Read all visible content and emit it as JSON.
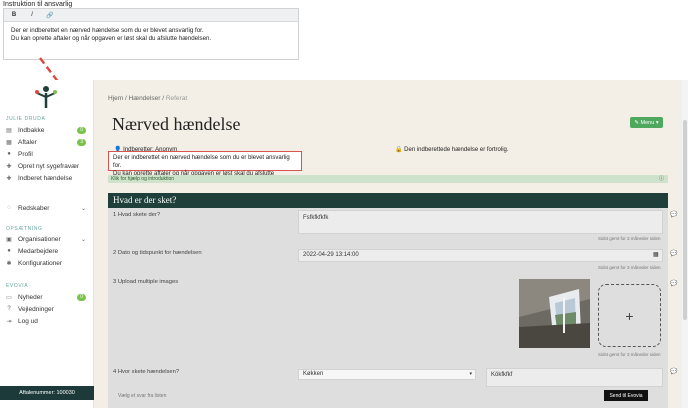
{
  "editor": {
    "title": "Instruktion til ansvarlig",
    "toolbar": {
      "bold": "B",
      "italic": "I",
      "link": "🔗"
    },
    "line1": "Der er indberettet en nærved hændelse som du er blevet ansvarlig for.",
    "line2": "Du kan oprette aftaler og når opgaven er løst skal du afslutte hændelsen."
  },
  "sidebar": {
    "section1": "JULIE DRUDA",
    "items1": [
      {
        "label": "Indbakke",
        "badge": "0",
        "icon": "inbox-icon"
      },
      {
        "label": "Aftaler",
        "badge": "3",
        "icon": "calendar-icon"
      },
      {
        "label": "Profil",
        "icon": "person-icon"
      },
      {
        "label": "Opret nyt sygefravær",
        "icon": "plus-icon"
      },
      {
        "label": "Indberet hændelse",
        "icon": "plus-icon"
      }
    ],
    "redskaber": "Redskaber",
    "section2": "OPSÆTNING",
    "items2": [
      {
        "label": "Organisationer",
        "icon": "org-icon"
      },
      {
        "label": "Medarbejdere",
        "icon": "person-icon"
      },
      {
        "label": "Konfigurationer",
        "icon": "gear-icon"
      }
    ],
    "section3": "EVOVIA",
    "items3": [
      {
        "label": "Nyheder",
        "badge": "0",
        "icon": "news-icon"
      },
      {
        "label": "Vejledninger",
        "icon": "question-icon"
      },
      {
        "label": "Log ud",
        "icon": "logout-icon"
      }
    ],
    "footer": "Aftalenummer: 100030"
  },
  "page": {
    "breadcrumb": [
      "Hjem",
      "Hændelser",
      "Referat"
    ],
    "title": "Nærved hændelse",
    "menu": "Menu",
    "reporter": "Indberetter: Anonym",
    "confidential": "Den indberettede hændelse er fortrolig.",
    "desc_line1": "Der er indberettet en nærved hændelse som du er blevet ansvarlig for.",
    "desc_line2": "Du kan oprette aftaler og når opgaven er løst skal du afslutte hændelsen.",
    "help": "Klik for hjælp og introduktion",
    "section": "Hvad er der sket?"
  },
  "questions": {
    "q1": {
      "label": "1 Hvad skete der?",
      "value": "Fsfkfkfkfk",
      "saved": "Sidst gemt for 3 måneder siden"
    },
    "q2": {
      "label": "2 Dato og tidspunkt for hændelsen",
      "value": "2022-04-29 13:14:00",
      "saved": "Sidst gemt for 3 måneder siden"
    },
    "q3": {
      "label": "3 Upload multiple images",
      "saved": "Sidst gemt for 3 måneder siden"
    },
    "q4": {
      "label": "4 Hvor skete hændelsen?",
      "select": "Køkken",
      "hint": "Vælg et svar fra listen",
      "text": "Kökfkfkf"
    }
  },
  "send": "Send til Evovia",
  "colors": {
    "accent": "#4ea85e",
    "section": "#1f3f3a",
    "highlight": "#d9534f"
  }
}
